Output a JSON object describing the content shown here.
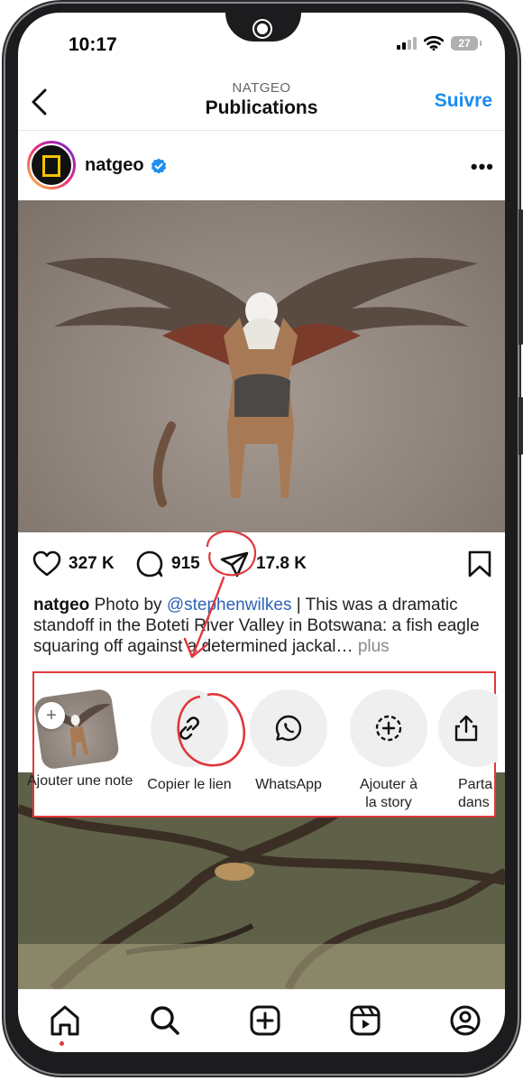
{
  "status_bar": {
    "time": "10:17",
    "battery": "27"
  },
  "header": {
    "account": "NATGEO",
    "title": "Publications",
    "follow_label": "Suivre"
  },
  "post": {
    "username": "natgeo",
    "likes": "327 K",
    "comments": "915",
    "shares": "17.8 K",
    "caption": {
      "username": "natgeo",
      "prefix": "Photo by ",
      "mention": "@stephenwilkes",
      "text": " | This was a dramatic standoff in the Boteti River Valley in Botswana: a fish eagle squaring off against a determined jackal… ",
      "more": "plus"
    }
  },
  "share_sheet": {
    "items": [
      {
        "label": "Ajouter une note",
        "icon": "note-add-icon"
      },
      {
        "label": "Copier le lien",
        "icon": "link-icon"
      },
      {
        "label": "WhatsApp",
        "icon": "whatsapp-icon"
      },
      {
        "label": "Ajouter à\nla story",
        "icon": "add-story-icon"
      },
      {
        "label": "Parta\ndans",
        "icon": "share-icon"
      }
    ]
  },
  "bottom_nav": [
    "home-icon",
    "search-icon",
    "create-icon",
    "reels-icon",
    "profile-icon"
  ],
  "colors": {
    "follow_blue": "#1a8cf0",
    "annotation_red": "#e0383b",
    "mention_blue": "#2e62b8"
  }
}
